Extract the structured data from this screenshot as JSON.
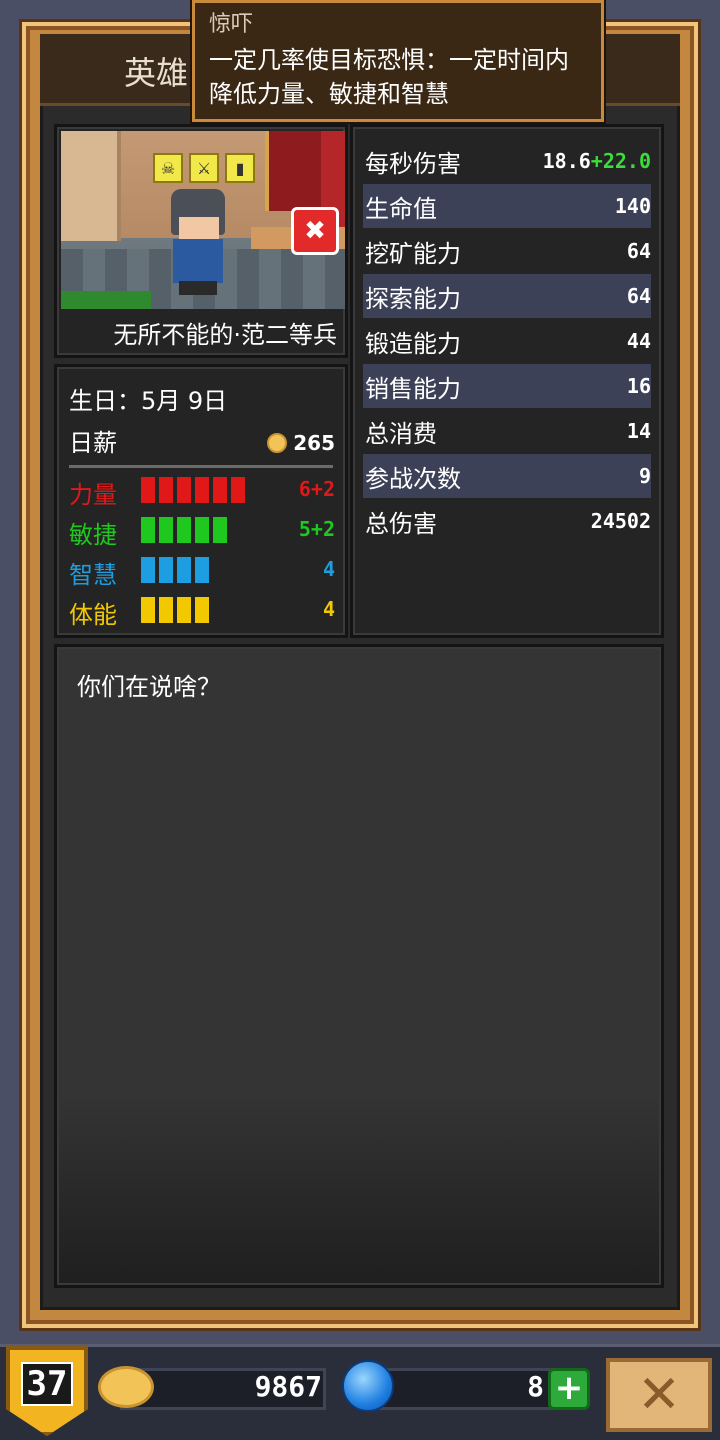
{
  "window": {
    "title": "英雄"
  },
  "tooltip": {
    "title": "惊吓",
    "description": "一定几率使目标恐惧：一定时间内降低力量、敏捷和智慧"
  },
  "hero": {
    "name": "无所不能的·范二等兵",
    "birthday": "生日：5月 9日",
    "salary_label": "日薪",
    "salary_value": "265",
    "status_icons": [
      "skull-icon",
      "slash-icon",
      "door-icon"
    ],
    "badge_icon": "fear-icon"
  },
  "attributes": [
    {
      "label": "力量",
      "value": "6+2",
      "bars": 6,
      "color": "#e01818"
    },
    {
      "label": "敏捷",
      "value": "5+2",
      "bars": 5,
      "color": "#1ec81e"
    },
    {
      "label": "智慧",
      "value": "4",
      "bars": 4,
      "color": "#1c9ee0"
    },
    {
      "label": "体能",
      "value": "4",
      "bars": 4,
      "color": "#f2c800"
    }
  ],
  "stats": [
    {
      "label": "每秒伤害",
      "value": "18.6",
      "bonus": "+22.0"
    },
    {
      "label": "生命值",
      "value": "140",
      "bonus": ""
    },
    {
      "label": "挖矿能力",
      "value": "64",
      "bonus": ""
    },
    {
      "label": "探索能力",
      "value": "64",
      "bonus": ""
    },
    {
      "label": "锻造能力",
      "value": "44",
      "bonus": ""
    },
    {
      "label": "销售能力",
      "value": "16",
      "bonus": ""
    },
    {
      "label": "总消费",
      "value": "14",
      "bonus": ""
    },
    {
      "label": "参战次数",
      "value": "9",
      "bonus": ""
    },
    {
      "label": "总伤害",
      "value": "24502",
      "bonus": ""
    }
  ],
  "dialogue": {
    "text": "你们在说啥？"
  },
  "footer": {
    "level": "37",
    "gold": "9867",
    "gems": "8",
    "add_label": "+",
    "close_label": "✕"
  }
}
